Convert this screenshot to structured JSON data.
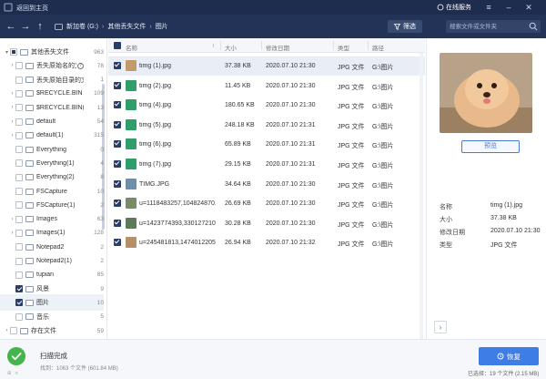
{
  "window": {
    "title": "返回到主页",
    "online_service": "在线服务"
  },
  "toolbar": {
    "breadcrumb": [
      "新加卷 (G:)",
      "其他丢失文件",
      "图片"
    ],
    "filter_label": "筛选",
    "search_placeholder": "搜索文件或文件夹"
  },
  "sidebar": {
    "items": [
      {
        "label": "其他丢失文件",
        "count": "963",
        "state": "partial",
        "arrow": "▾",
        "indent": 0
      },
      {
        "label": "丢失原始名的文件",
        "count": "78",
        "state": "none",
        "arrow": "›",
        "indent": 1,
        "help": true
      },
      {
        "label": "丢失原始目录的文件",
        "count": "1",
        "state": "none",
        "arrow": "",
        "indent": 1
      },
      {
        "label": "$RECYCLE.BIN",
        "count": "109",
        "state": "none",
        "arrow": "›",
        "indent": 1
      },
      {
        "label": "$RECYCLE.BIN(1)",
        "count": "13",
        "state": "none",
        "arrow": "›",
        "indent": 1
      },
      {
        "label": "default",
        "count": "54",
        "state": "none",
        "arrow": "›",
        "indent": 1
      },
      {
        "label": "default(1)",
        "count": "315",
        "state": "none",
        "arrow": "›",
        "indent": 1
      },
      {
        "label": "Everything",
        "count": "0",
        "state": "none",
        "arrow": "",
        "indent": 1
      },
      {
        "label": "Everything(1)",
        "count": "4",
        "state": "none",
        "arrow": "",
        "indent": 1
      },
      {
        "label": "Everything(2)",
        "count": "8",
        "state": "none",
        "arrow": "",
        "indent": 1
      },
      {
        "label": "FSCapture",
        "count": "10",
        "state": "none",
        "arrow": "",
        "indent": 1
      },
      {
        "label": "FSCapture(1)",
        "count": "2",
        "state": "none",
        "arrow": "",
        "indent": 1
      },
      {
        "label": "Images",
        "count": "63",
        "state": "none",
        "arrow": "›",
        "indent": 1
      },
      {
        "label": "Images(1)",
        "count": "128",
        "state": "none",
        "arrow": "›",
        "indent": 1
      },
      {
        "label": "Notepad2",
        "count": "2",
        "state": "none",
        "arrow": "",
        "indent": 1
      },
      {
        "label": "Notepad2(1)",
        "count": "2",
        "state": "none",
        "arrow": "",
        "indent": 1
      },
      {
        "label": "tupian",
        "count": "85",
        "state": "none",
        "arrow": "",
        "indent": 1
      },
      {
        "label": "风景",
        "count": "9",
        "state": "checked",
        "arrow": "",
        "indent": 1
      },
      {
        "label": "图片",
        "count": "10",
        "state": "checked",
        "arrow": "",
        "indent": 1,
        "selected": true
      },
      {
        "label": "音乐",
        "count": "5",
        "state": "none",
        "arrow": "",
        "indent": 1
      },
      {
        "label": "存在文件",
        "count": "59",
        "state": "none",
        "arrow": "›",
        "indent": 0
      }
    ]
  },
  "table": {
    "columns": [
      "名称",
      "大小",
      "修改日期",
      "类型",
      "路径"
    ],
    "rows": [
      {
        "name": "timg (1).jpg",
        "size": "37.38 KB",
        "date": "2020.07.10 21:30",
        "type": "JPG 文件",
        "path": "G:\\图片",
        "thumb": "#c49a6c",
        "selected": true
      },
      {
        "name": "timg (2).jpg",
        "size": "11.45 KB",
        "date": "2020.07.10 21:30",
        "type": "JPG 文件",
        "path": "G:\\图片",
        "thumb": "#2f9e6b"
      },
      {
        "name": "timg (4).jpg",
        "size": "180.65 KB",
        "date": "2020.07.10 21:30",
        "type": "JPG 文件",
        "path": "G:\\图片",
        "thumb": "#2f9e6b"
      },
      {
        "name": "timg (5).jpg",
        "size": "248.18 KB",
        "date": "2020.07.10 21:31",
        "type": "JPG 文件",
        "path": "G:\\图片",
        "thumb": "#2f9e6b"
      },
      {
        "name": "timg (6).jpg",
        "size": "65.89 KB",
        "date": "2020.07.10 21:31",
        "type": "JPG 文件",
        "path": "G:\\图片",
        "thumb": "#2f9e6b"
      },
      {
        "name": "timg (7).jpg",
        "size": "29.15 KB",
        "date": "2020.07.10 21:31",
        "type": "JPG 文件",
        "path": "G:\\图片",
        "thumb": "#2f9e6b"
      },
      {
        "name": "TIMG.JPG",
        "size": "34.64 KB",
        "date": "2020.07.10 21:30",
        "type": "JPG 文件",
        "path": "G:\\图片",
        "thumb": "#6f8fa8"
      },
      {
        "name": "u=1118483257,104824870...",
        "size": "26.69 KB",
        "date": "2020.07.10 21:30",
        "type": "JPG 文件",
        "path": "G:\\图片",
        "thumb": "#7a8a6a"
      },
      {
        "name": "u=1423774393,330127210...",
        "size": "30.28 KB",
        "date": "2020.07.10 21:30",
        "type": "JPG 文件",
        "path": "G:\\图片",
        "thumb": "#5e7a5a"
      },
      {
        "name": "u=245481813,1474012205...",
        "size": "26.94 KB",
        "date": "2020.07.10 21:32",
        "type": "JPG 文件",
        "path": "G:\\图片",
        "thumb": "#b59068"
      }
    ]
  },
  "preview": {
    "button_label": "预览",
    "fields": [
      {
        "key": "名称",
        "value": "timg (1).jpg"
      },
      {
        "key": "大小",
        "value": "37.38 KB"
      },
      {
        "key": "修改日期",
        "value": "2020.07.10 21:30"
      },
      {
        "key": "类型",
        "value": "JPG 文件"
      }
    ]
  },
  "status": {
    "title": "扫描完成",
    "subtitle": "找到：1063 个文件 (601.84 MB)",
    "recover_label": "恢复",
    "selected_info": "已选择：19 个文件 (2.15 MB)"
  },
  "colors": {
    "titlebar": "#1e2d4e",
    "toolbar": "#233357",
    "accent": "#3f7de6",
    "success": "#43b54a"
  }
}
